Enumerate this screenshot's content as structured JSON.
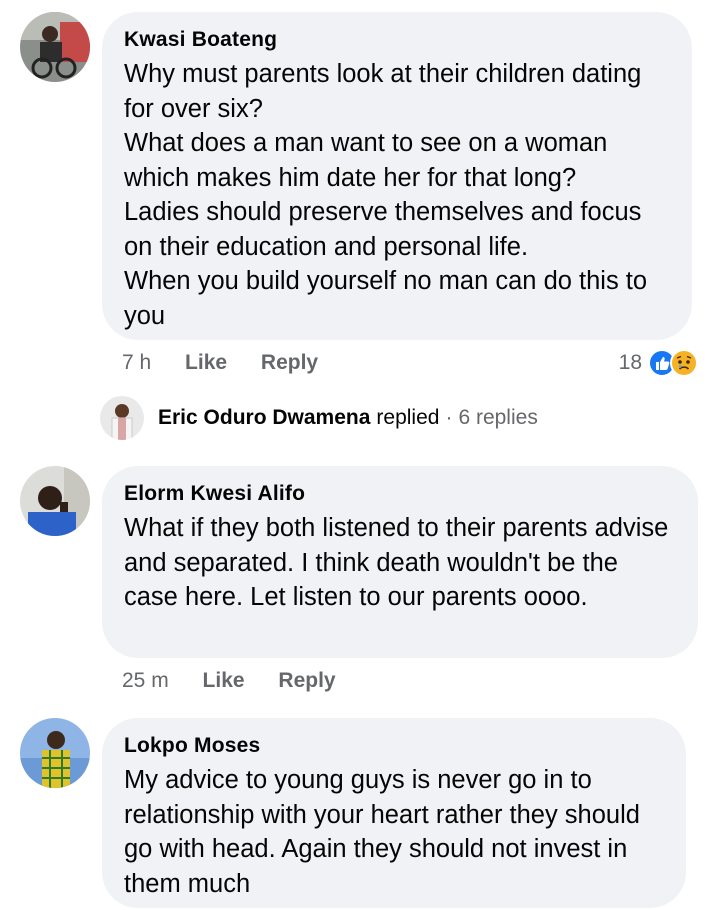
{
  "comments": [
    {
      "author": "Kwasi Boateng",
      "lines": [
        "Why must parents look at their children dating for over six?",
        "What does a man want to see on a woman which makes him date her for that long?",
        "Ladies should preserve themselves and focus on their education and personal life.",
        "When you build yourself no man can do this to you"
      ],
      "time": "7 h",
      "like_label": "Like",
      "reply_label": "Reply",
      "reaction_count": "18",
      "reactions": [
        "like-icon",
        "sad-icon"
      ]
    },
    {
      "author": "Elorm Kwesi Alifo",
      "lines": [
        "What if they both listened to their parents advise and separated. I think death wouldn't be the case here. Let listen to our parents oooo."
      ],
      "time": "25 m",
      "like_label": "Like",
      "reply_label": "Reply"
    },
    {
      "author": "Lokpo Moses",
      "lines": [
        "My advice to young guys is never go in to relationship with your heart rather they should go with head. Again they should not invest in them much"
      ]
    }
  ],
  "reply_summary": {
    "name": "Eric Oduro Dwamena",
    "verb": "replied",
    "separator": "·",
    "count_text": "6 replies"
  },
  "colors": {
    "bubble": "#f0f2f5",
    "secondary_text": "#65676b",
    "like_blue": "#1877f2",
    "sad_yellow": "#f7b125"
  }
}
